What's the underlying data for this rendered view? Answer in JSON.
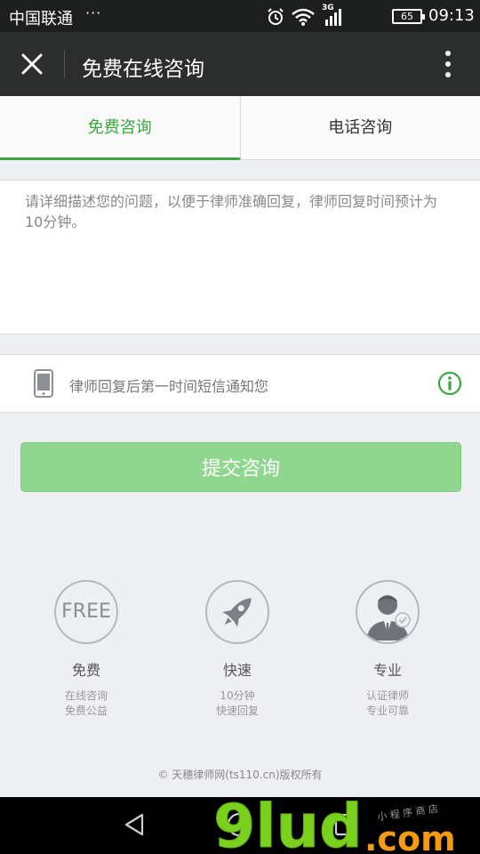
{
  "status_bar": {
    "carrier": "中国联通",
    "dots": "···",
    "network": "3G",
    "battery": "65",
    "time": "09:13"
  },
  "title_bar": {
    "title": "免费在线咨询"
  },
  "tabs": [
    {
      "label": "免费咨询",
      "active": true
    },
    {
      "label": "电话咨询",
      "active": false
    }
  ],
  "question": {
    "placeholder": "请详细描述您的问题，以便于律师准确回复，律师回复时间预计为10分钟。",
    "value": ""
  },
  "sms_notice": {
    "text": "律师回复后第一时间短信通知您"
  },
  "submit": {
    "label": "提交咨询"
  },
  "features": [
    {
      "badge": "FREE",
      "title": "免费",
      "desc1": "在线咨询",
      "desc2": "免费公益"
    },
    {
      "title": "快速",
      "desc1": "10分钟",
      "desc2": "快速回复"
    },
    {
      "title": "专业",
      "desc1": "认证律师",
      "desc2": "专业可靠"
    }
  ],
  "copyright": "© 天穗律师网(ts110.cn)版权所有",
  "watermark": {
    "logo": "9lud",
    "suffix": ".com",
    "tag": "小 程 序 商 店"
  },
  "colors": {
    "accent": "#3aa63f",
    "submit_bg": "#8fd68f",
    "title_bar": "#2b2e2c",
    "status_bar": "#1c1f1d"
  }
}
